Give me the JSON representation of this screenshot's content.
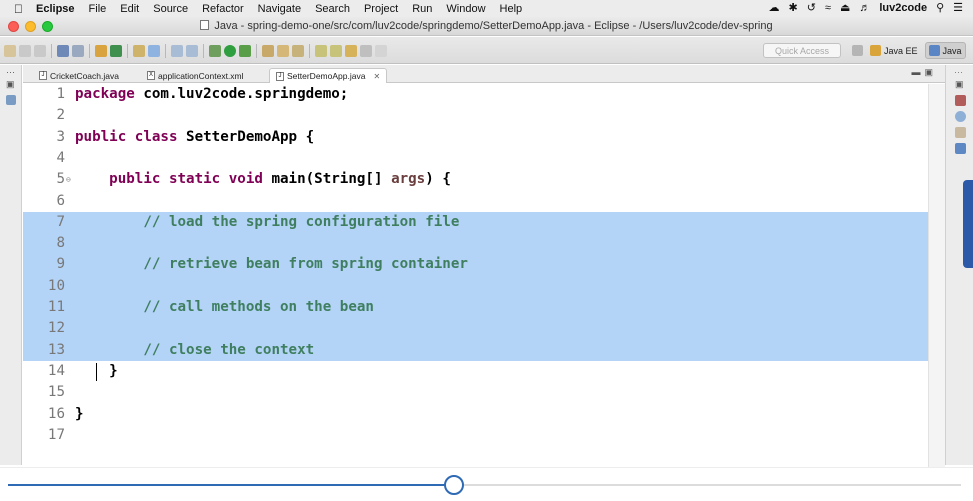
{
  "menubar": {
    "app_name": "Eclipse",
    "items": [
      "File",
      "Edit",
      "Source",
      "Refactor",
      "Navigate",
      "Search",
      "Project",
      "Run",
      "Window",
      "Help"
    ],
    "user": "luv2code"
  },
  "window": {
    "title": "Java - spring-demo-one/src/com/luv2code/springdemo/SetterDemoApp.java - Eclipse - /Users/luv2code/dev-spring"
  },
  "toolbar": {
    "quick_access_placeholder": "Quick Access",
    "perspectives": [
      "Java EE",
      "Java"
    ],
    "active_perspective": "Java"
  },
  "editor_tabs": [
    {
      "label": "CricketCoach.java",
      "icon": "java-file-icon",
      "active": false
    },
    {
      "label": "applicationContext.xml",
      "icon": "xml-file-icon",
      "active": false
    },
    {
      "label": "SetterDemoApp.java",
      "icon": "java-file-icon",
      "active": true
    }
  ],
  "code": {
    "selected_lines": [
      7,
      8,
      9,
      10,
      11,
      12,
      13
    ],
    "caret_line": 14,
    "lines": [
      {
        "n": "1",
        "tokens": [
          {
            "t": "package ",
            "c": "kw"
          },
          {
            "t": "com.luv2code.springdemo;",
            "c": "bl"
          }
        ]
      },
      {
        "n": "2",
        "tokens": []
      },
      {
        "n": "3",
        "tokens": [
          {
            "t": "public class ",
            "c": "kw"
          },
          {
            "t": "SetterDemoApp {",
            "c": "bl"
          }
        ]
      },
      {
        "n": "4",
        "tokens": []
      },
      {
        "n": "5",
        "fold": true,
        "tokens": [
          {
            "t": "    ",
            "c": "bl"
          },
          {
            "t": "public static void ",
            "c": "kw"
          },
          {
            "t": "main(String[] ",
            "c": "bl"
          },
          {
            "t": "args",
            "c": "param"
          },
          {
            "t": ") {",
            "c": "bl"
          }
        ]
      },
      {
        "n": "6",
        "tokens": []
      },
      {
        "n": "7",
        "tokens": [
          {
            "t": "        // load the spring configuration file",
            "c": "cm"
          }
        ]
      },
      {
        "n": "8",
        "tokens": []
      },
      {
        "n": "9",
        "tokens": [
          {
            "t": "        // retrieve bean from spring container",
            "c": "cm"
          }
        ]
      },
      {
        "n": "10",
        "tokens": []
      },
      {
        "n": "11",
        "tokens": [
          {
            "t": "        // call methods on the bean",
            "c": "cm"
          }
        ]
      },
      {
        "n": "12",
        "tokens": []
      },
      {
        "n": "13",
        "tokens": [
          {
            "t": "        // close the context",
            "c": "cm"
          }
        ]
      },
      {
        "n": "14",
        "tokens": [
          {
            "t": "    }",
            "c": "bl"
          }
        ]
      },
      {
        "n": "15",
        "tokens": []
      },
      {
        "n": "16",
        "tokens": [
          {
            "t": "}",
            "c": "bl"
          }
        ]
      },
      {
        "n": "17",
        "tokens": []
      }
    ]
  },
  "video": {
    "progress": 0.468
  },
  "colors": {
    "selection": "#b3d3f7",
    "keyword": "#7f0055",
    "comment": "#3f7f5f",
    "parameter": "#6a3e3e",
    "progress": "#2f6ab5"
  }
}
